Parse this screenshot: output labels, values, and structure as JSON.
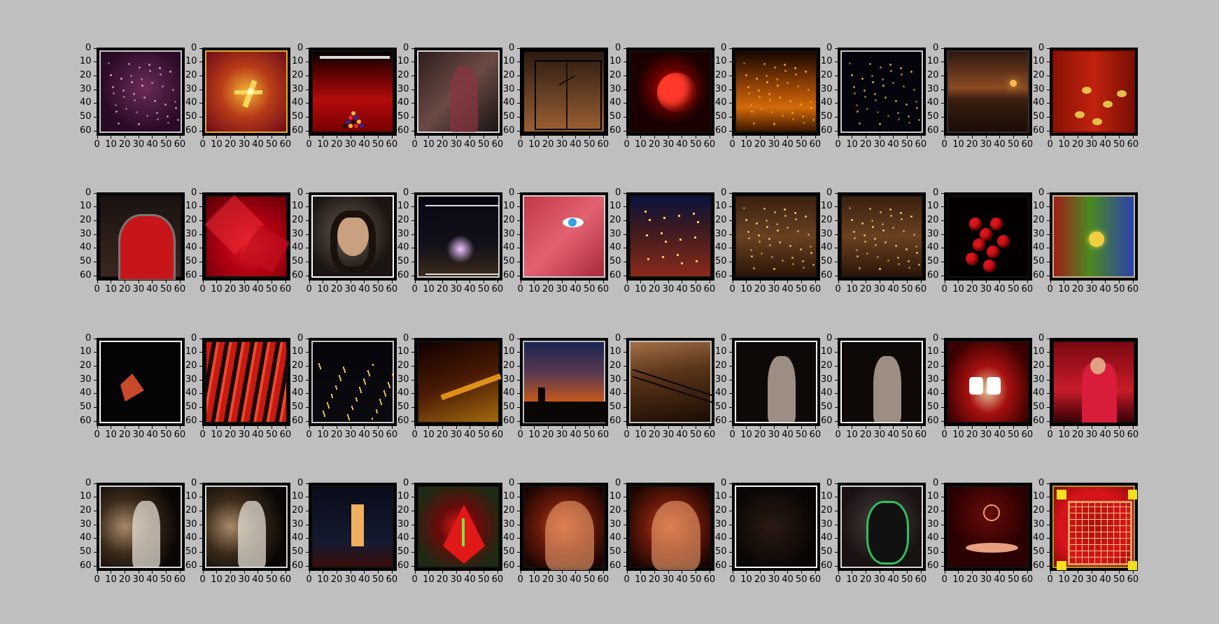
{
  "chart_data": {
    "type": "image-grid",
    "rows": 4,
    "cols": 10,
    "axes": {
      "x_ticks": [
        "0",
        "10",
        "20",
        "30",
        "40",
        "50",
        "60"
      ],
      "y_ticks": [
        "0",
        "10",
        "20",
        "30",
        "40",
        "50",
        "60"
      ],
      "xlim": [
        0,
        64
      ],
      "ylim": [
        64,
        0
      ]
    },
    "panels": [
      {
        "id": 1,
        "bg": "radial-gradient(circle at 55% 45%, #6a2c58 0%, #2a0a25 70%)",
        "border": "#c8c8c8",
        "accent": "#e9a8d2",
        "dots": "sparkle"
      },
      {
        "id": 2,
        "bg": "radial-gradient(circle at 50% 50%, #f2b23a 0%, #b83c16 45%, #6e0a1c 100%)",
        "border": "#e2b024",
        "accent": "#f7d65a",
        "dots": "rays"
      },
      {
        "id": 3,
        "bg": "linear-gradient(180deg, #000 0%, #4a0000 20%, #b30b0b 60%, #7a0000 100%)",
        "border": "#111",
        "accent": "#e7c36b",
        "dots": "billiard"
      },
      {
        "id": 4,
        "bg": "linear-gradient(135deg, #2e1e1c 0%, #6b4a45 50%, #1a1413 100%)",
        "border": "#d8d8d8",
        "accent": "#8a3340",
        "dots": "figure"
      },
      {
        "id": 5,
        "bg": "linear-gradient(180deg, #2a1a10 0%, #9b6034 100%)",
        "border": "#000",
        "accent": "#1a0f08",
        "dots": "branch"
      },
      {
        "id": 6,
        "bg": "radial-gradient(circle at 52% 45%, #d4130e 0%, #6a0000 30%, #1a0000 60%)",
        "border": "#111",
        "accent": "#ff3a2a",
        "dots": "rose"
      },
      {
        "id": 7,
        "bg": "linear-gradient(180deg, #160600 0%, #8a3e05 40%, #d46a0a 70%, #3a1500 100%)",
        "border": "#111",
        "accent": "#ffb23a",
        "dots": "sparkle"
      },
      {
        "id": 8,
        "bg": "#05040c",
        "border": "#c8c8c8",
        "accent": "#d9b55a",
        "dots": "sparkle"
      },
      {
        "id": 9,
        "bg": "linear-gradient(180deg, #2e1810 0%, #8a4a22 45%, #3a1e12 60%, #1a0c06 100%)",
        "border": "#333",
        "accent": "#ffb84a",
        "dots": "sun"
      },
      {
        "id": 10,
        "bg": "linear-gradient(90deg, #8a1206 0%, #c1220e 50%, #7a0e04 100%)",
        "border": "#7a0e04",
        "accent": "#e2c04a",
        "dots": "flowers"
      },
      {
        "id": 11,
        "bg": "linear-gradient(180deg, #1a1210 0%, #3a2620 100%)",
        "border": "#111",
        "accent": "#c8151a",
        "dots": "door"
      },
      {
        "id": 12,
        "bg": "radial-gradient(circle at 55% 62%, #e2202a 0%, #b30012 40%, #5a0006 100%)",
        "border": "#111",
        "accent": "#ff5a5a",
        "dots": "petals"
      },
      {
        "id": 13,
        "bg": "radial-gradient(circle at 45% 45%, #6a5a50 0%, #1a1512 70%)",
        "border": "#ffffff",
        "accent": "#c9a080",
        "dots": "face"
      },
      {
        "id": 14,
        "bg": "linear-gradient(180deg, #060612 0%, #12101a 60%, #3a2a1a 100%)",
        "border": "#d0d0d0",
        "accent": "#f0c6ff",
        "dots": "fountain"
      },
      {
        "id": 15,
        "bg": "linear-gradient(135deg, #c03848 0%, #e26272 50%, #a82a3a 100%)",
        "border": "#d0d0d0",
        "accent": "#36a0e0",
        "dots": "eye"
      },
      {
        "id": 16,
        "bg": "linear-gradient(180deg, #0b1240 0%, #3a1a20 40%, #8a2a1a 100%)",
        "border": "#111",
        "accent": "#ffcf6a",
        "dots": "street"
      },
      {
        "id": 17,
        "bg": "linear-gradient(180deg, #3a2010 0%, #6a4020 50%, #2a1608 100%)",
        "border": "#111",
        "accent": "#ffd28a",
        "dots": "sparkle"
      },
      {
        "id": 18,
        "bg": "linear-gradient(180deg, #3a2010 0%, #6a4020 50%, #2a1608 100%)",
        "border": "#111",
        "accent": "#ffd28a",
        "dots": "sparkle"
      },
      {
        "id": 19,
        "bg": "#050000",
        "border": "#111",
        "accent": "#d8151a",
        "dots": "berries"
      },
      {
        "id": 20,
        "bg": "linear-gradient(90deg, #a21c1c 0%, #4a8a1e 45%, #2a40b0 100%)",
        "border": "#c8b890",
        "accent": "#f0d040",
        "dots": "bloom"
      },
      {
        "id": 21,
        "bg": "#040404",
        "border": "#ffffff",
        "accent": "#c84a2a",
        "dots": "shard"
      },
      {
        "id": 22,
        "bg": "repeating-linear-gradient(100deg, #c81a10 0px, #c81a10 8px, #1a0404 8px, #1a0404 14px, #e84a30 14px, #e84a30 18px)",
        "border": "#111",
        "accent": "#ff8a6a",
        "dots": "none"
      },
      {
        "id": 23,
        "bg": "linear-gradient(180deg, #05050a 0%, #0a0a10 100%)",
        "border": "#c8c8c8",
        "accent": "#f0c050",
        "dots": "city"
      },
      {
        "id": 24,
        "bg": "linear-gradient(160deg, #100000 0%, #4a1a04 50%, #a26a10 100%)",
        "border": "#111",
        "accent": "#e0901a",
        "dots": "alley"
      },
      {
        "id": 25,
        "bg": "linear-gradient(180deg, #1a2450 0%, #5a3a50 40%, #c8581a 75%, #1a0a06 100%)",
        "border": "#c0c0c0",
        "accent": "#0a0604",
        "dots": "skyline"
      },
      {
        "id": 26,
        "bg": "linear-gradient(170deg, #a27048 0%, #5a3418 40%, #1a0c04 100%)",
        "border": "#c0c0c0",
        "accent": "#0a0604",
        "dots": "lines"
      },
      {
        "id": 27,
        "bg": "#0e0806",
        "border": "#ffffff",
        "accent": "#d8c8b8",
        "dots": "figure"
      },
      {
        "id": 28,
        "bg": "#0e0806",
        "border": "#ffffff",
        "accent": "#d8c8b8",
        "dots": "figure"
      },
      {
        "id": 29,
        "bg": "radial-gradient(ellipse at 50% 60%, #e8d0a0 0%, #a81010 35%, #3a0000 80%)",
        "border": "#111",
        "accent": "#ffffff",
        "dots": "mouth"
      },
      {
        "id": 30,
        "bg": "linear-gradient(180deg, #7a0810 0%, #c81c2a 60%, #3a0006 100%)",
        "border": "#111",
        "accent": "#e0a080",
        "dots": "monk"
      },
      {
        "id": 31,
        "bg": "radial-gradient(circle at 30% 50%, #a88a6a 0%, #3a2a1a 40%, #0a0604 80%)",
        "border": "#d8d8d8",
        "accent": "#f0e8e0",
        "dots": "figure"
      },
      {
        "id": 32,
        "bg": "radial-gradient(circle at 30% 50%, #a88a6a 0%, #3a2a1a 40%, #0a0604 80%)",
        "border": "#d8d8d8",
        "accent": "#f0e8e0",
        "dots": "figure"
      },
      {
        "id": 33,
        "bg": "linear-gradient(180deg, #0a0c1a 0%, #141a30 70%, #3a0e0a 100%)",
        "border": "#111",
        "accent": "#f0b060",
        "dots": "tower"
      },
      {
        "id": 34,
        "bg": "radial-gradient(circle at 50% 50%, #d81a1a 0%, #6a0a0a 35%, #1e2a14 80%)",
        "border": "#111",
        "accent": "#80e040",
        "dots": "lily"
      },
      {
        "id": 35,
        "bg": "radial-gradient(circle at 50% 50%, #c05020 0%, #6a1a0a 45%, #1a0402 90%)",
        "border": "#111",
        "accent": "#f0a070",
        "dots": "dancer"
      },
      {
        "id": 36,
        "bg": "radial-gradient(circle at 50% 50%, #c05020 0%, #6a1a0a 45%, #1a0402 90%)",
        "border": "#111",
        "accent": "#f0a070",
        "dots": "dancer"
      },
      {
        "id": 37,
        "bg": "radial-gradient(circle at 45% 50%, #2a1a14 0%, #0a0604 70%)",
        "border": "#ffffff",
        "accent": "#c8b0a0",
        "dots": "none"
      },
      {
        "id": 38,
        "bg": "radial-gradient(circle at 50% 45%, #4a4040 0%, #1a1212 70%)",
        "border": "#d8d8d8",
        "accent": "#30c060",
        "dots": "mask"
      },
      {
        "id": 39,
        "bg": "radial-gradient(circle at 50% 35%, #6a0a0a 0%, #2a0000 60%)",
        "border": "#111",
        "accent": "#e8a080",
        "dots": "hands"
      },
      {
        "id": 40,
        "bg": "radial-gradient(circle at 50% 50%, #a81010 0%, #d8141a 60%, #8a0a0a 100%)",
        "border": "#a0a030",
        "accent": "#f0e020",
        "dots": "tiles"
      }
    ]
  }
}
